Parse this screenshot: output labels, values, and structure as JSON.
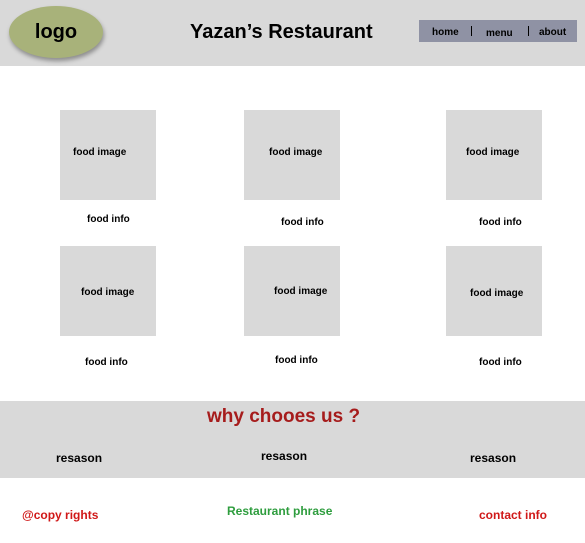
{
  "header": {
    "logo_text": "logo",
    "title": "Yazan’s Restaurant",
    "nav": [
      "home",
      "menu",
      "about"
    ]
  },
  "menu_grid": {
    "cards": [
      {
        "image_label": "food image",
        "info": "food info"
      },
      {
        "image_label": "food image",
        "info": "food info"
      },
      {
        "image_label": "food image",
        "info": "food info"
      },
      {
        "image_label": "food image",
        "info": "food info"
      },
      {
        "image_label": "food image",
        "info": "food info"
      },
      {
        "image_label": "food image",
        "info": "food info"
      }
    ]
  },
  "why": {
    "title": "why chooes us ?",
    "reasons": [
      "resason",
      "resason",
      "resason"
    ]
  },
  "footer": {
    "copyright": "@copy rights",
    "phrase": "Restaurant phrase",
    "contact": "contact info"
  },
  "colors": {
    "header_bg": "#d9d9d9",
    "logo_bg": "#a8b27a",
    "nav_bg": "#8f92a4",
    "accent_red": "#a61c1c",
    "footer_red": "#d01818",
    "footer_green": "#2e9d3e"
  }
}
